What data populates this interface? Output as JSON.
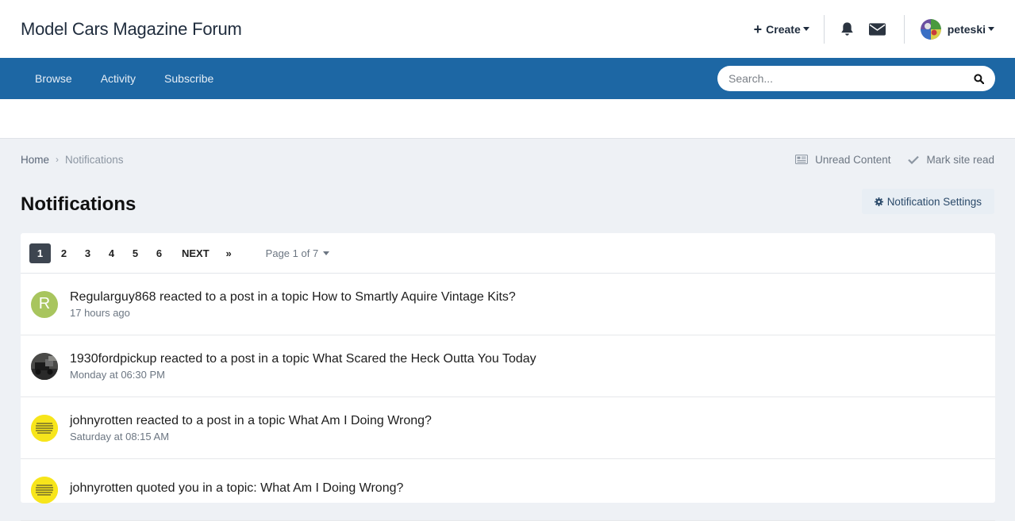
{
  "header": {
    "site_title": "Model Cars Magazine Forum",
    "create_label": "Create",
    "username": "peteski"
  },
  "nav": {
    "items": [
      {
        "label": "Browse"
      },
      {
        "label": "Activity"
      },
      {
        "label": "Subscribe"
      }
    ],
    "search_placeholder": "Search..."
  },
  "breadcrumb": {
    "home": "Home",
    "current": "Notifications",
    "unread_content": "Unread Content",
    "mark_site_read": "Mark site read"
  },
  "page": {
    "title": "Notifications",
    "settings_label": "Notification Settings"
  },
  "pagination": {
    "pages": [
      "1",
      "2",
      "3",
      "4",
      "5",
      "6"
    ],
    "active": "1",
    "next_label": "NEXT",
    "last_label": "»",
    "page_of": "Page 1 of 7"
  },
  "notifications": [
    {
      "avatar_letter": "R",
      "title": "Regularguy868 reacted to a post in a topic How to Smartly Aquire Vintage Kits?",
      "time": "17 hours ago"
    },
    {
      "avatar_letter": "",
      "title": "1930fordpickup reacted to a post in a topic What Scared the Heck Outta You Today",
      "time": "Monday at 06:30 PM"
    },
    {
      "avatar_letter": "",
      "title": "johnyrotten reacted to a post in a topic What Am I Doing Wrong?",
      "time": "Saturday at 08:15 AM"
    },
    {
      "avatar_letter": "",
      "title": "johnyrotten quoted you in a topic: What Am I Doing Wrong?",
      "time": ""
    }
  ],
  "colors": {
    "nav_bg": "#1d67a4",
    "page_bg": "#eef1f5",
    "pager_active": "#3d4550"
  }
}
